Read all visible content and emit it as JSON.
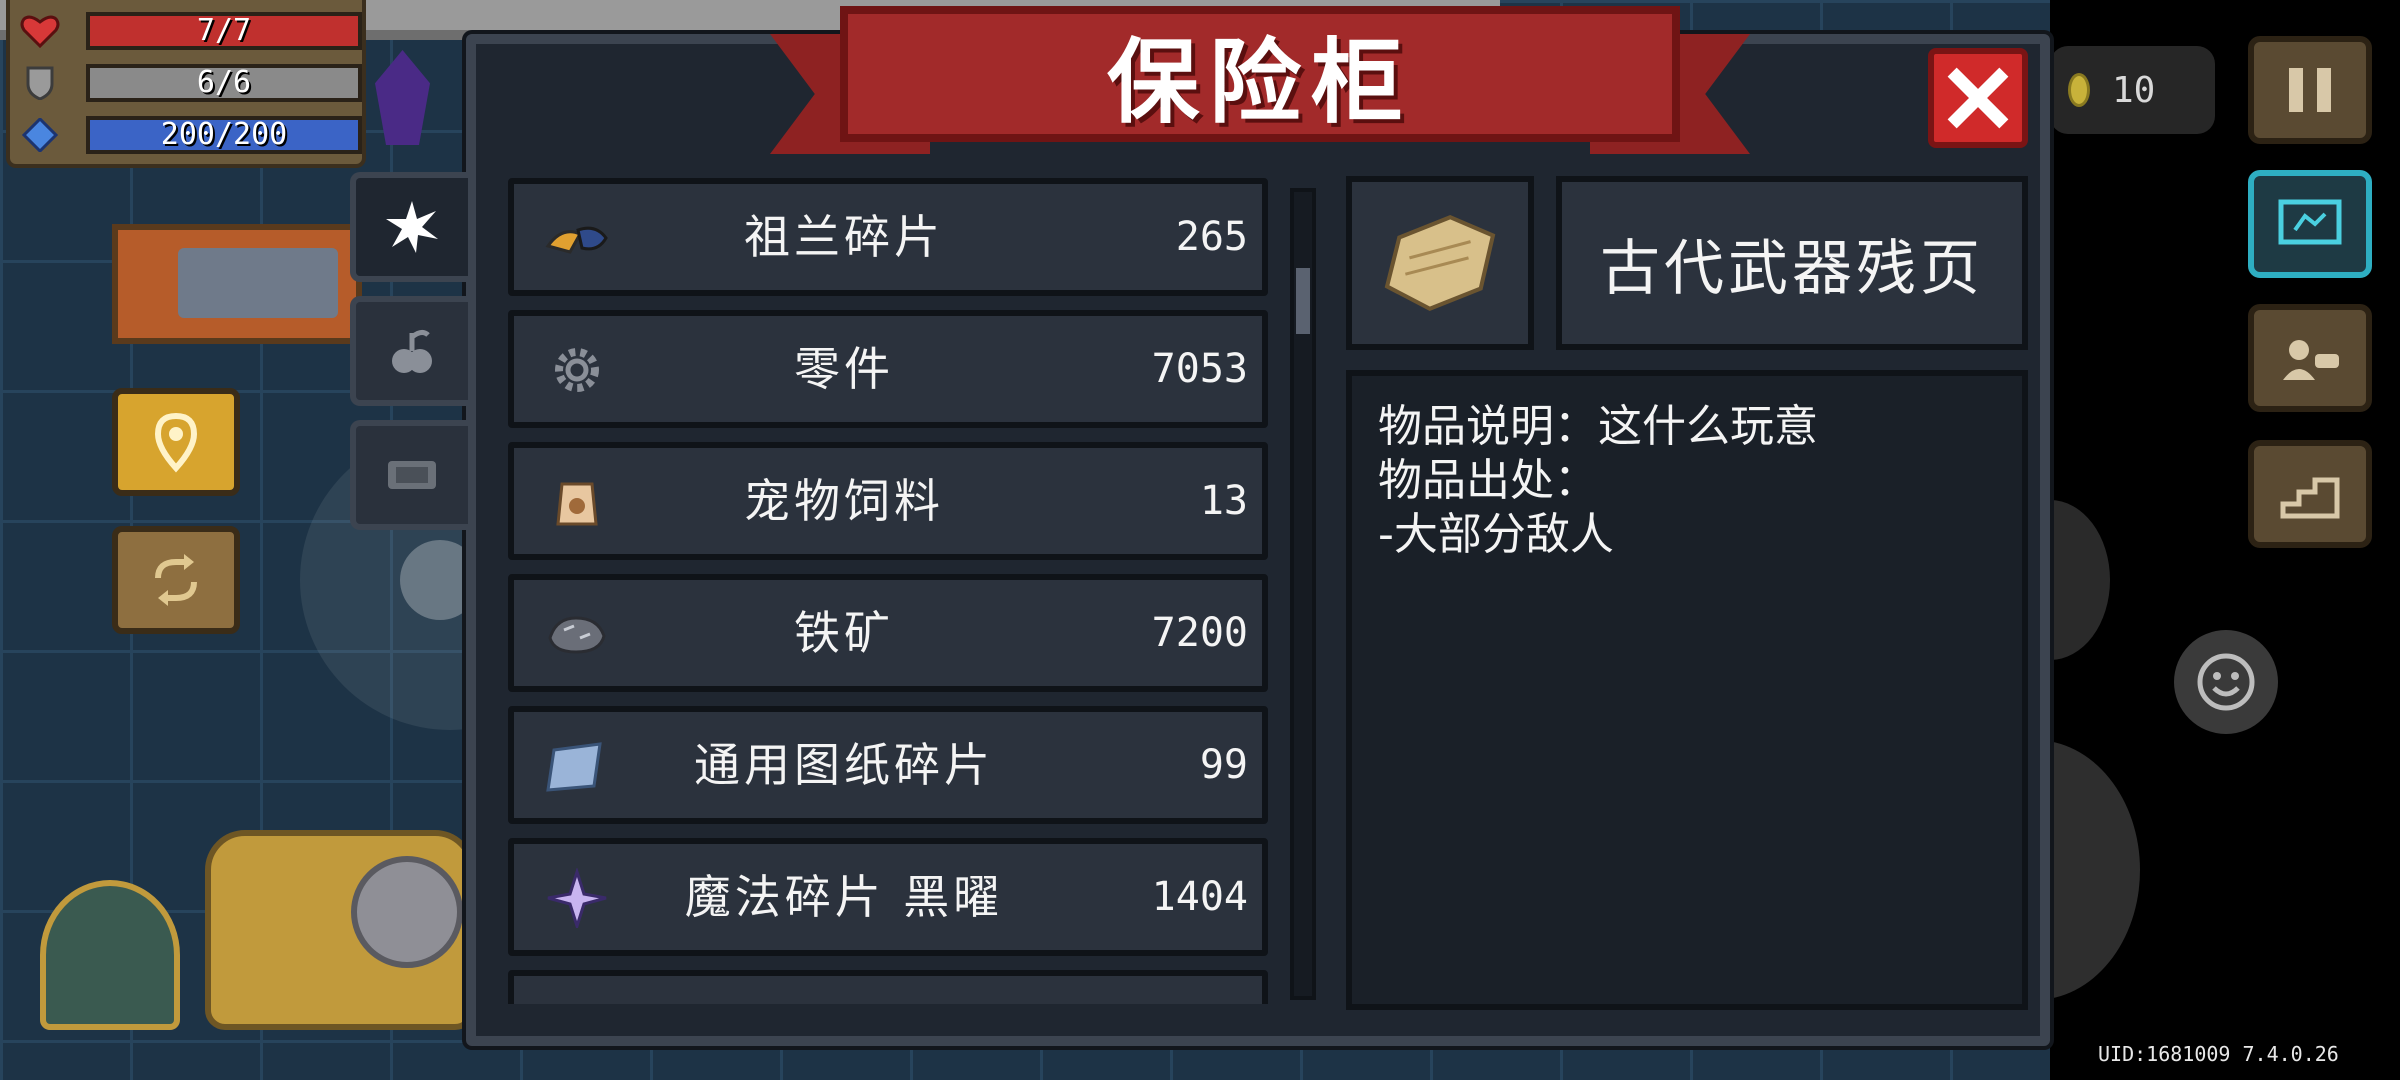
{
  "hud": {
    "hp": "7/7",
    "armor": "6/6",
    "energy": "200/200",
    "coins": "10",
    "uid": "UID:1681009 7.4.0.26"
  },
  "vault": {
    "title": "保险柜",
    "tabs": [
      {
        "icon": "star-burst-icon"
      },
      {
        "icon": "plant-icon"
      },
      {
        "icon": "ticket-icon"
      }
    ],
    "items": [
      {
        "name": "祖兰碎片",
        "count": "265",
        "icon": "zulan-shard-icon"
      },
      {
        "name": "零件",
        "count": "7053",
        "icon": "gear-part-icon"
      },
      {
        "name": "宠物饲料",
        "count": "13",
        "icon": "pet-food-icon"
      },
      {
        "name": "铁矿",
        "count": "7200",
        "icon": "iron-ore-icon"
      },
      {
        "name": "通用图纸碎片",
        "count": "99",
        "icon": "blueprint-fragment-icon"
      },
      {
        "name": "魔法碎片 黑曜",
        "count": "1404",
        "icon": "obsidian-magic-shard-icon"
      }
    ],
    "detail": {
      "name": "古代武器残页",
      "icon": "ancient-page-icon",
      "lines": [
        "物品说明：这什么玩意",
        "物品出处：",
        "-大部分敌人"
      ]
    }
  },
  "colors": {
    "hp": "#c0302e",
    "armor": "#8a8a8a",
    "energy": "#3b64c6",
    "ribbon": "#a22a2a",
    "close": "#d02a2a"
  }
}
